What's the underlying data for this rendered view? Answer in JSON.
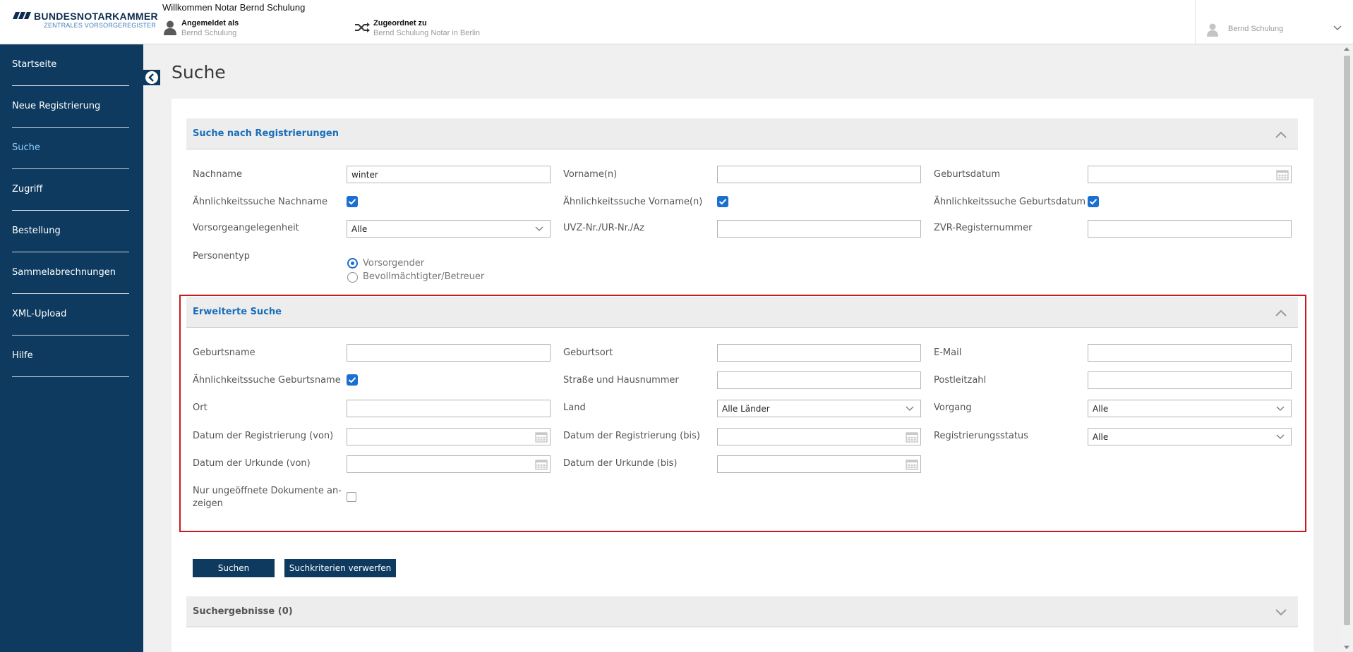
{
  "header": {
    "logo_title": "BUNDESNOTARKAMMER",
    "logo_subtitle": "ZENTRALES VORSORGEREGISTER",
    "welcome": "Willkommen Notar Bernd Schulung",
    "logged_in_label": "Angemeldet als",
    "logged_in_value": "Bernd Schulung",
    "assigned_label": "Zugeordnet zu",
    "assigned_value": "Bernd Schulung Notar in Berlin",
    "user_menu": "Bernd Schulung"
  },
  "sidebar": {
    "items": [
      {
        "label": "Startseite",
        "active": false
      },
      {
        "label": "Neue Registrierung",
        "active": false
      },
      {
        "label": "Suche",
        "active": true
      },
      {
        "label": "Zugriff",
        "active": false
      },
      {
        "label": "Bestellung",
        "active": false
      },
      {
        "label": "Sammelabrechnungen",
        "active": false
      },
      {
        "label": "XML-Upload",
        "active": false
      },
      {
        "label": "Hilfe",
        "active": false
      }
    ]
  },
  "page": {
    "title": "Suche"
  },
  "search": {
    "title": "Suche nach Registrierungen",
    "nachname_label": "Nachname",
    "nachname_value": "winter",
    "vorname_label": "Vorname(n)",
    "vorname_value": "",
    "geburtsdatum_label": "Geburtsdatum",
    "geburtsdatum_value": "",
    "aehnl_nachname_label": "Ähnlichkeitssuche Nachname",
    "aehnl_nachname_checked": true,
    "aehnl_vorname_label": "Ähnlichkeitssuche Vorname(n)",
    "aehnl_vorname_checked": true,
    "aehnl_geburtsdatum_label": "Ähnlichkeitssuche Geburtsdatum",
    "aehnl_geburtsdatum_checked": true,
    "vorsorge_label": "Vorsorgeangelegenheit",
    "vorsorge_value": "Alle",
    "uvz_label": "UVZ-Nr./UR-Nr./Az",
    "uvz_value": "",
    "zvr_label": "ZVR-Registernummer",
    "zvr_value": "",
    "personentyp_label": "Personentyp",
    "personentyp_options": [
      "Vorsorgender",
      "Bevollmächtigter/Betreuer"
    ],
    "personentyp_selected": "Vorsorgender"
  },
  "advanced": {
    "title": "Erweiterte Suche",
    "geburtsname_label": "Geburtsname",
    "geburtsname_value": "",
    "geburtsort_label": "Geburtsort",
    "geburtsort_value": "",
    "email_label": "E-Mail",
    "email_value": "",
    "aehnl_geburtsname_label": "Ähnlichkeitssuche Geburtsname",
    "aehnl_geburtsname_checked": true,
    "strasse_label": "Straße und Hausnummer",
    "strasse_value": "",
    "plz_label": "Postleitzahl",
    "plz_value": "",
    "ort_label": "Ort",
    "ort_value": "",
    "land_label": "Land",
    "land_value": "Alle Länder",
    "vorgang_label": "Vorgang",
    "vorgang_value": "Alle",
    "reg_von_label": "Datum der Registrierung (von)",
    "reg_von_value": "",
    "reg_bis_label": "Datum der Registrierung (bis)",
    "reg_bis_value": "",
    "regstatus_label": "Registrierungsstatus",
    "regstatus_value": "Alle",
    "urk_von_label": "Datum der Urkunde (von)",
    "urk_von_value": "",
    "urk_bis_label": "Datum der Urkunde (bis)",
    "urk_bis_value": "",
    "ungeoeffnet_label_line1": "Nur ungeöffnete Dokumente an-",
    "ungeoeffnet_label_line2": "zeigen",
    "ungeoeffnet_checked": false
  },
  "actions": {
    "search_label": "Suchen",
    "reset_label": "Suchkriterien verwerfen"
  },
  "results": {
    "title": "Suchergebnisse (0)"
  },
  "colors": {
    "sidebar": "#0d3a5e",
    "accent": "#1a6fba",
    "highlight_border": "#c8191d",
    "checkbox": "#1a6fd0"
  }
}
